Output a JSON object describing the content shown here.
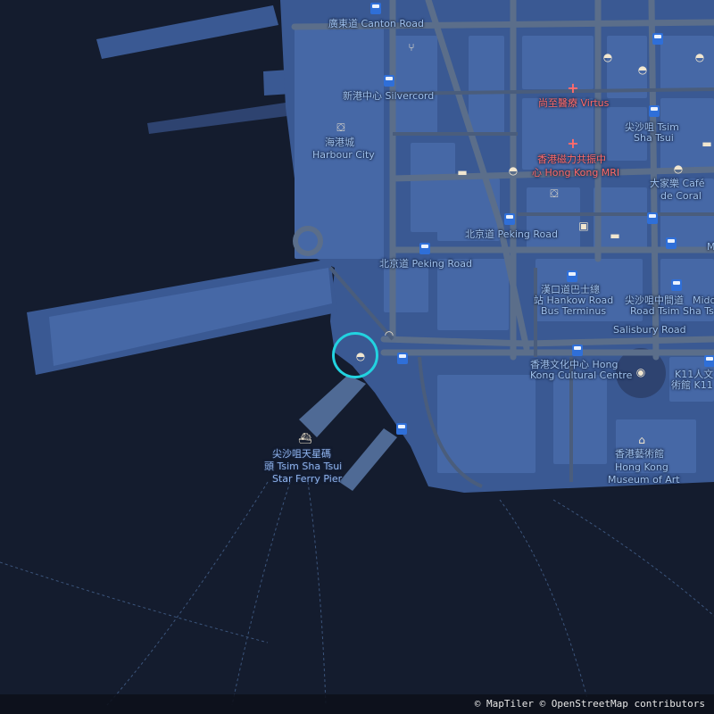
{
  "map": {
    "colors": {
      "water": "#141c2e",
      "land": "#3a5993",
      "block": "#3c5c99",
      "road": "#5b6e8a",
      "road_minor": "#4a5d7c",
      "marker": "#22d3e0",
      "text": "#9fc2ef",
      "medical": "#ff6b6b"
    },
    "labels": {
      "canton_road": "廣東道 Canton Road",
      "silvercord": "新港中心 Silvercord",
      "virtus": "尚至醫療 Virtus",
      "tst_1": "尖沙咀 Tsim",
      "tst_2": "Sha Tsui",
      "mri_1": "香港磁力共振中",
      "mri_2": "心 Hong Kong MRI",
      "harbour_1": "海港城",
      "harbour_2": "Harbour City",
      "cafe_1": "大家樂 Café",
      "cafe_2": "de Coral",
      "peking_stop": "北京道 Peking Road",
      "peking_road": "北京道 Peking Road",
      "hankow_1": "漢口道巴士總",
      "hankow_2": "站 Hankow Road",
      "hankow_3": "Bus Terminus",
      "middle_1": "尖沙咀中間道",
      "middle_2": "Road Tsim Sha Ts",
      "middle_prefix_1": "Midd",
      "salisbury": "Salisbury Road",
      "cultural_1": "香港文化中心 Hong",
      "cultural_2": "Kong Cultural Centre",
      "k11_1": "K11人文",
      "k11_2": "術館 K11",
      "museum_1": "香港藝術館",
      "museum_2": "Hong Kong",
      "museum_3": "Museum of Art",
      "ferry_1": "尖沙咀天星碼",
      "ferry_2": "頭 Tsim Sha Tsui",
      "ferry_3": "Star Ferry Pier",
      "edge_m": "M"
    },
    "icons": {
      "bus": "bus-stop-icon",
      "food": "fast-food-icon",
      "medical": "medical-cross-icon",
      "shop": "shopping-bag-icon",
      "hotel": "hotel-bed-icon",
      "bakery": "bakery-icon",
      "camera": "camera-icon",
      "museum": "museum-icon",
      "ferry": "ferry-icon",
      "restaurant": "restaurant-icon",
      "money": "money-icon"
    }
  },
  "attribution": "© MapTiler © OpenStreetMap contributors"
}
